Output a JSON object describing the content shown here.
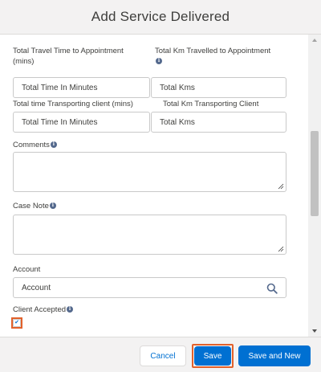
{
  "modal": {
    "title": "Add Service Delivered"
  },
  "form": {
    "travel_time": {
      "label": "Total Travel Time to Appointment (mins)",
      "placeholder": "Total Time In Minutes"
    },
    "travel_km": {
      "label": "Total Km Travelled to Appointment",
      "placeholder": "Total Kms"
    },
    "transport_time": {
      "label": "Total time Transporting client (mins)",
      "placeholder": "Total Time In Minutes"
    },
    "transport_km": {
      "label": "Total Km Transporting Client",
      "placeholder": "Total Kms"
    },
    "comments": {
      "label": "Comments"
    },
    "case_note": {
      "label": "Case Note"
    },
    "account": {
      "label": "Account",
      "placeholder": "Account"
    },
    "client_accepted": {
      "label": "Client Accepted",
      "checked": true
    }
  },
  "footer": {
    "cancel_label": "Cancel",
    "save_label": "Save",
    "save_new_label": "Save and New"
  },
  "colors": {
    "brand": "#0070d2",
    "highlight": "#e2612b"
  }
}
